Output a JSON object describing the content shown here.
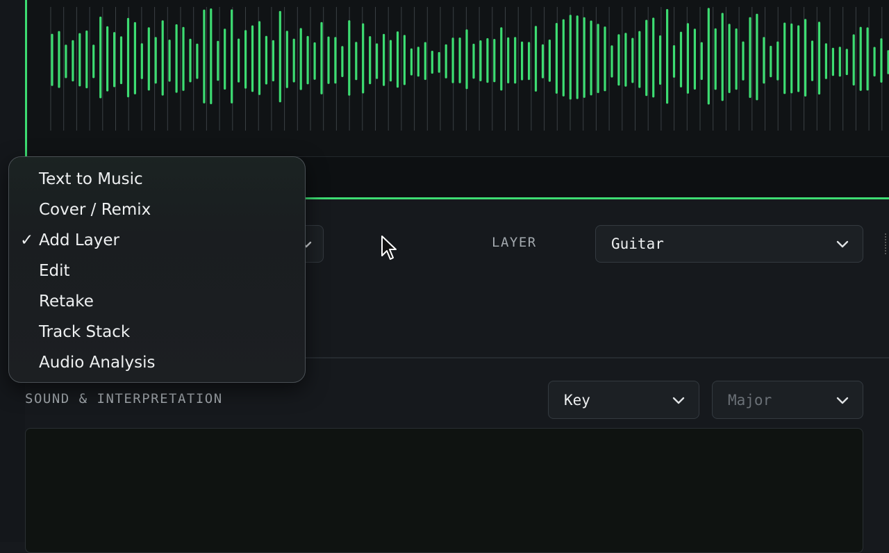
{
  "colors": {
    "accent": "#3ddc72",
    "background": "#16191d",
    "panel": "#101315"
  },
  "mode_menu": {
    "items": [
      {
        "label": "Text to Music",
        "selected": false
      },
      {
        "label": "Cover / Remix",
        "selected": false
      },
      {
        "label": "Add Layer",
        "selected": true
      },
      {
        "label": "Edit",
        "selected": false
      },
      {
        "label": "Retake",
        "selected": false
      },
      {
        "label": "Track Stack",
        "selected": false
      },
      {
        "label": "Audio Analysis",
        "selected": false
      }
    ],
    "check_glyph": "✓"
  },
  "layer": {
    "label": "LAYER",
    "value": "Guitar"
  },
  "sound": {
    "section_label": "SOUND & INTERPRETATION",
    "key_value": "Key",
    "scale_placeholder": "Major"
  },
  "icons": {
    "chevron": "chevron-down-icon",
    "cursor": "mouse-pointer-icon"
  }
}
